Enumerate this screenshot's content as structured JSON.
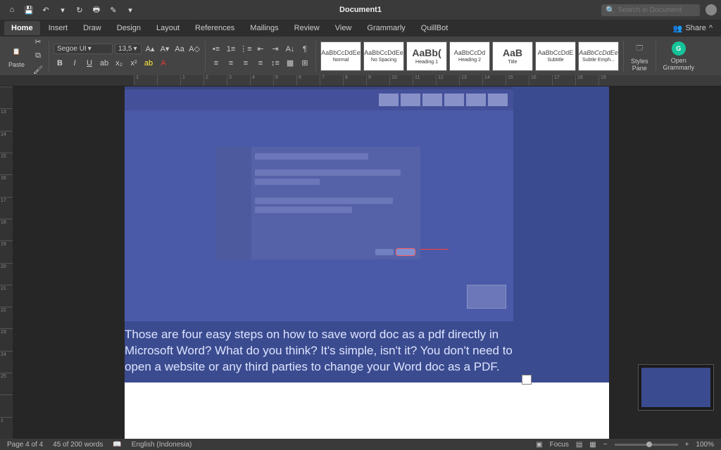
{
  "titlebar": {
    "doc_title": "Document1",
    "search_placeholder": "Search in Document"
  },
  "tabs": {
    "items": [
      "Home",
      "Insert",
      "Draw",
      "Design",
      "Layout",
      "References",
      "Mailings",
      "Review",
      "View",
      "Grammarly",
      "QuillBot"
    ],
    "share": "Share"
  },
  "ribbon": {
    "paste": "Paste",
    "font_name": "Segoe UI",
    "font_size": "13,5",
    "styles": [
      {
        "preview": "AaBbCcDdEe",
        "label": "Normal"
      },
      {
        "preview": "AaBbCcDdEe",
        "label": "No Spacing"
      },
      {
        "preview": "AaBb(",
        "label": "Heading 1"
      },
      {
        "preview": "AaBbCcDd",
        "label": "Heading 2"
      },
      {
        "preview": "AaB",
        "label": "Title"
      },
      {
        "preview": "AaBbCcDdE",
        "label": "Subtitle"
      },
      {
        "preview": "AaBbCcDdEe",
        "label": "Subtle Emph..."
      }
    ],
    "styles_pane": "Styles\nPane",
    "open_grammarly": "Open\nGrammarly"
  },
  "document": {
    "body_text": "Those are four easy steps on how to save word doc as a pdf directly in Microsoft Word? What do you think? It's simple, isn't it? You don't need to open a website or any third parties to change your Word doc as a PDF."
  },
  "statusbar": {
    "page": "Page 4 of 4",
    "words": "45 of 200 words",
    "language": "English (Indonesia)",
    "focus": "Focus",
    "zoom": "100%"
  },
  "ruler_marks": [
    "1",
    "",
    "1",
    "2",
    "3",
    "4",
    "5",
    "6",
    "7",
    "8",
    "9",
    "10",
    "11",
    "12",
    "13",
    "14",
    "15",
    "16",
    "17",
    "18",
    "19"
  ],
  "ruler_v": [
    "",
    "13",
    "14",
    "15",
    "16",
    "17",
    "18",
    "19",
    "20",
    "21",
    "22",
    "23",
    "24",
    "25",
    "",
    "1"
  ]
}
